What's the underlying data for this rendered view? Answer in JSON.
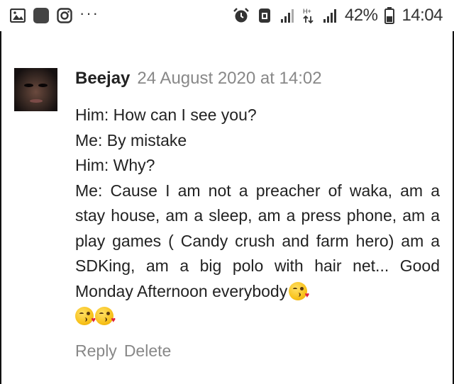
{
  "status_bar": {
    "battery_percent": "42%",
    "time": "14:04",
    "overflow_dots": "···",
    "network_tag": "H+",
    "icons": [
      "gallery-icon",
      "app-square-icon",
      "instagram-icon",
      "alarm-icon",
      "nfc-icon",
      "signal-bars-icon",
      "data-arrows-icon",
      "signal-bars-icon",
      "battery-icon"
    ]
  },
  "comment": {
    "author": "Beejay",
    "timestamp": "24 August 2020 at 14:02",
    "lines": [
      "Him: How can I see you?",
      "Me: By mistake",
      "Him: Why?",
      "Me: Cause I am not a preacher of waka, am a stay house, am a sleep, am a press phone, am a play games ( Candy crush and farm hero) am a SDKing, am a big polo with hair net... Good Monday Afternoon everybody"
    ],
    "emoji": "kissing-face-with-heart-icon",
    "emoji_count": 3
  },
  "actions": {
    "reply_label": "Reply",
    "delete_label": "Delete"
  },
  "colors": {
    "text": "#222222",
    "muted": "#888888",
    "border": "#111111"
  }
}
